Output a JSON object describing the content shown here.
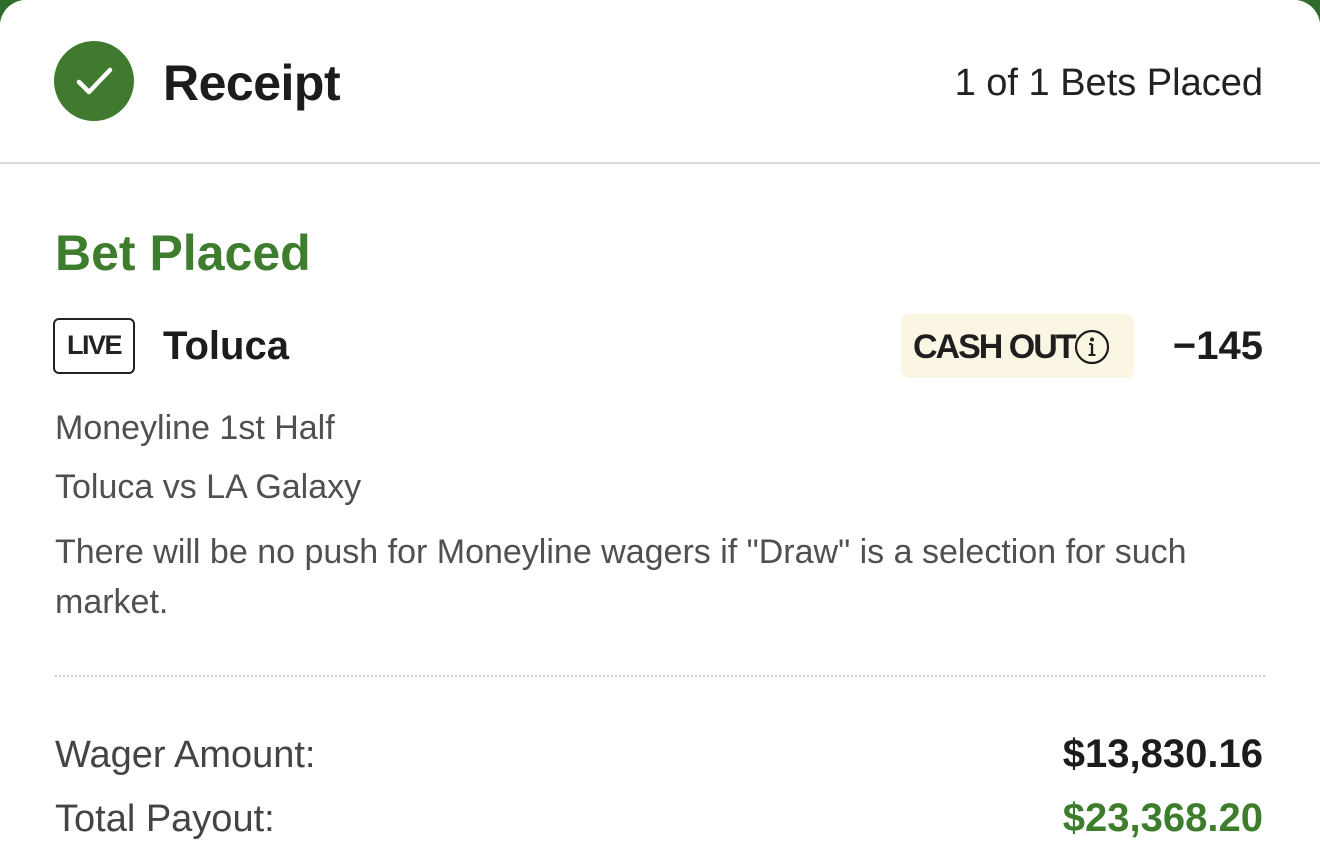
{
  "header": {
    "title": "Receipt",
    "bets_count": "1 of 1 Bets Placed",
    "icon": "check-circle-icon"
  },
  "bet": {
    "status": "Bet Placed",
    "live_badge": "LIVE",
    "selection": "Toluca",
    "cash_out_label": "CASH OUT",
    "odds": "−145",
    "market": "Moneyline 1st Half",
    "event": "Toluca vs LA Galaxy",
    "rules_note": "There will be no push for Moneyline wagers if \"Draw\" is a selection for such market."
  },
  "summary": {
    "wager_label": "Wager Amount:",
    "wager_value": "$13,830.16",
    "payout_label": "Total Payout:",
    "payout_value": "$23,368.20"
  },
  "colors": {
    "brand_green": "#3e7d2d",
    "cash_out_bg": "#fbf6e4"
  }
}
